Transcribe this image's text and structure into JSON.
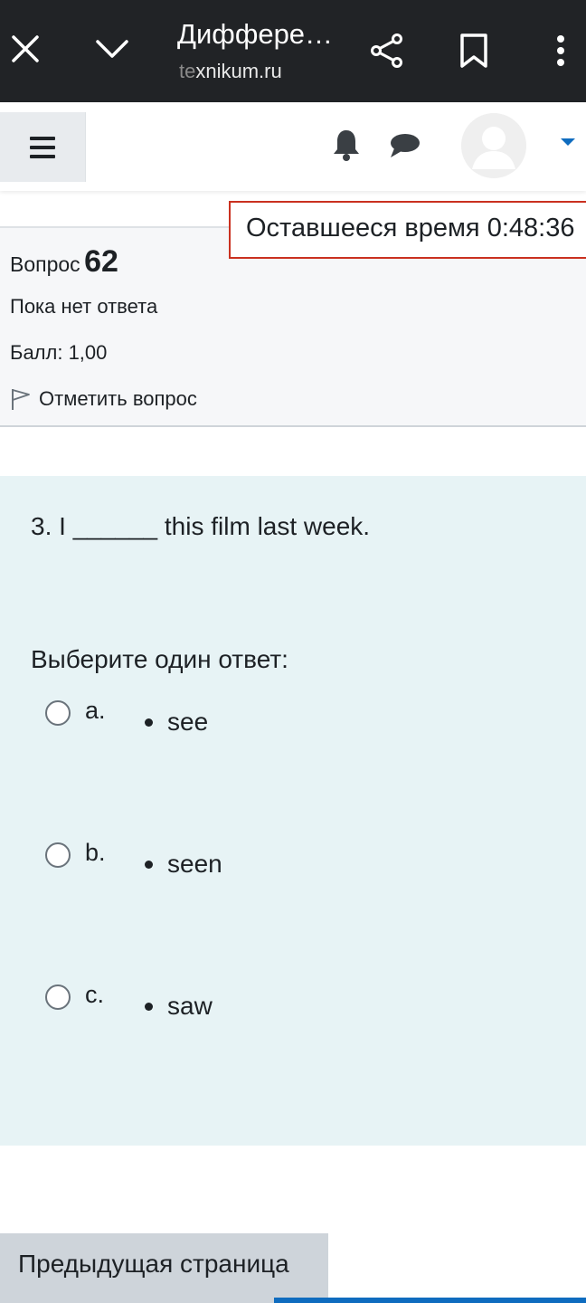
{
  "browser": {
    "title": "Диффере…",
    "domain_faded": "te",
    "domain_rest": "xnikum.ru"
  },
  "timer": {
    "label": "Оставшееся время",
    "value": "0:48:36"
  },
  "question_info": {
    "number_label": "Вопрос",
    "number": "62",
    "state": "Пока нет ответа",
    "grade": "Балл: 1,00",
    "flag_label": "Отметить вопрос"
  },
  "question": {
    "text": "3. I ______ this film last week.",
    "prompt": "Выберите один ответ:",
    "answers": [
      {
        "letter": "a.",
        "text": "see"
      },
      {
        "letter": "b.",
        "text": "seen"
      },
      {
        "letter": "c.",
        "text": "saw"
      }
    ]
  },
  "navigation": {
    "prev_label": "Предыдущая страница"
  },
  "colors": {
    "topbar_bg": "#212326",
    "timer_border": "#ca3120",
    "content_bg": "#e7f3f5",
    "accent": "#0f6cbf"
  }
}
